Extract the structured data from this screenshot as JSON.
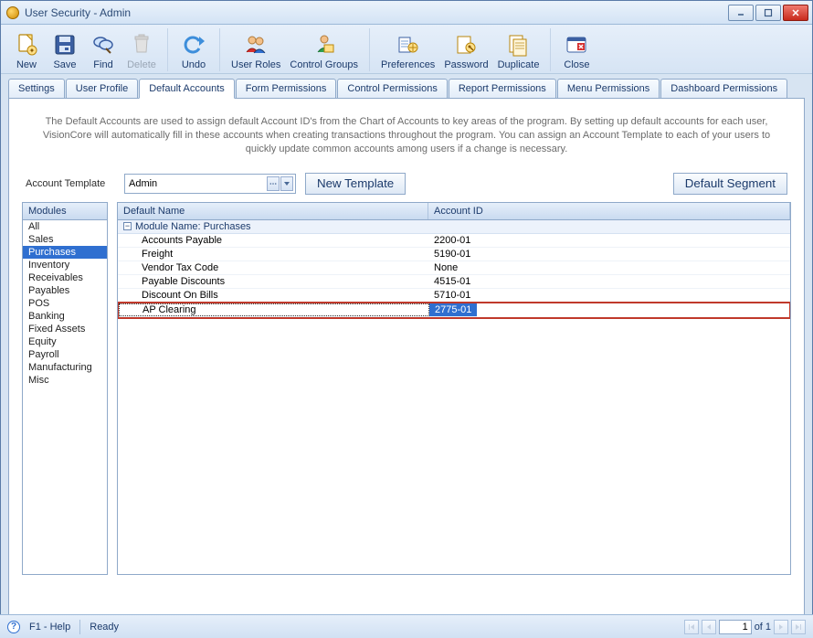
{
  "window": {
    "title": "User Security - Admin"
  },
  "toolbar": [
    {
      "name": "new-button",
      "label": "New"
    },
    {
      "name": "save-button",
      "label": "Save"
    },
    {
      "name": "find-button",
      "label": "Find"
    },
    {
      "name": "delete-button",
      "label": "Delete",
      "disabled": true
    },
    {
      "name": "undo-button",
      "label": "Undo"
    },
    {
      "name": "user-roles-button",
      "label": "User Roles"
    },
    {
      "name": "control-groups-button",
      "label": "Control Groups"
    },
    {
      "name": "preferences-button",
      "label": "Preferences"
    },
    {
      "name": "password-button",
      "label": "Password"
    },
    {
      "name": "duplicate-button",
      "label": "Duplicate"
    },
    {
      "name": "close-button",
      "label": "Close"
    }
  ],
  "tabs": [
    "Settings",
    "User Profile",
    "Default Accounts",
    "Form Permissions",
    "Control Permissions",
    "Report Permissions",
    "Menu Permissions",
    "Dashboard Permissions"
  ],
  "active_tab": "Default Accounts",
  "description": "The Default Accounts are used to assign default Account ID's from the Chart of Accounts to key areas of the program.  By setting up default accounts for each user, VisionCore will automatically fill in these accounts when creating transactions throughout the program.  You can assign an Account Template to each of your users to quickly update common accounts among users if a change is necessary.",
  "form": {
    "account_template_label": "Account Template",
    "account_template_value": "Admin",
    "new_template_label": "New Template",
    "default_segment_label": "Default Segment"
  },
  "modules_header": "Modules",
  "modules": [
    "All",
    "Sales",
    "Purchases",
    "Inventory",
    "Receivables",
    "Payables",
    "POS",
    "Banking",
    "Fixed Assets",
    "Equity",
    "Payroll",
    "Manufacturing",
    "Misc"
  ],
  "selected_module": "Purchases",
  "grid": {
    "headers": {
      "name": "Default Name",
      "acct": "Account ID"
    },
    "group_label": "Module Name: Purchases",
    "rows": [
      {
        "name": "Accounts Payable",
        "acct": "2200-01"
      },
      {
        "name": "Freight",
        "acct": "5190-01"
      },
      {
        "name": "Vendor Tax Code",
        "acct": "None"
      },
      {
        "name": "Payable Discounts",
        "acct": "4515-01"
      },
      {
        "name": "Discount On Bills",
        "acct": "5710-01"
      },
      {
        "name": "AP Clearing",
        "acct": "2775-01",
        "selected": true
      }
    ]
  },
  "status": {
    "help": "F1 - Help",
    "ready": "Ready",
    "page_current": "1",
    "page_of": "of",
    "page_total": "1"
  }
}
